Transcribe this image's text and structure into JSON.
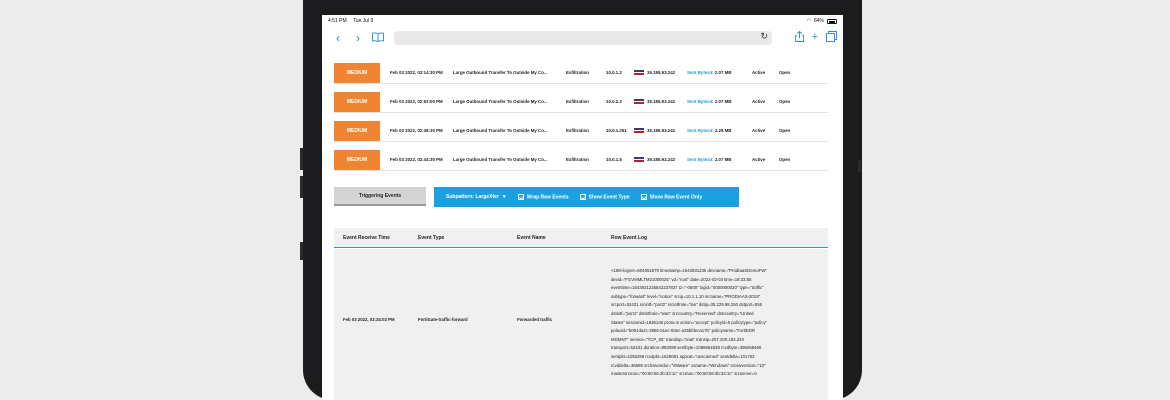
{
  "statusbar": {
    "time": "4:51 PM",
    "date": "Tue Jul 9",
    "battery": "84%"
  },
  "icons": {
    "back": "chevron-left-icon",
    "forward": "chevron-right-icon",
    "bookmarks": "book-icon",
    "reload": "reload-icon",
    "share": "share-icon",
    "new_tab": "plus-icon",
    "tabs": "tabs-icon",
    "wifi": "wifi-icon"
  },
  "colors": {
    "severity": "#ef8532",
    "accent": "#1ba1e2",
    "sent_label": "#1e9bd7"
  },
  "alerts": [
    {
      "severity": "MEDIUM",
      "time": "Feb 03 2022, 03:14:30 PM",
      "name": "Large Outbound Transfer To Outside My Co...",
      "category": "Exfiltration",
      "src_ip": "10.0.1.2",
      "dst_ip": "35.185.93.242",
      "sent_label": "Sent Bytes4:",
      "sent_value": "2.07 MB",
      "status": "Active",
      "state": "Open"
    },
    {
      "severity": "MEDIUM",
      "time": "Feb 03 2022, 02:52:00 PM",
      "name": "Large Outbound Transfer To Outside My Co...",
      "category": "Exfiltration",
      "src_ip": "10.0.2.2",
      "dst_ip": "35.185.93.242",
      "sent_label": "Sent Bytes4:",
      "sent_value": "2.07 MB",
      "status": "Active",
      "state": "Open"
    },
    {
      "severity": "MEDIUM",
      "time": "Feb 03 2022, 02:48:30 PM",
      "name": "Large Outbound Transfer To Outside My Co...",
      "category": "Exfiltration",
      "src_ip": "10.0.1.251",
      "dst_ip": "35.185.93.242",
      "sent_label": "Sent Bytes4:",
      "sent_value": "2.29 MB",
      "status": "Active",
      "state": "Open"
    },
    {
      "severity": "MEDIUM",
      "time": "Feb 03 2022, 02:44:30 PM",
      "name": "Large Outbound Transfer To Outside My Co...",
      "category": "Exfiltration",
      "src_ip": "10.0.1.5",
      "dst_ip": "35.185.93.242",
      "sent_label": "Sent Bytes4:",
      "sent_value": "2.07 MB",
      "status": "Active",
      "state": "Open"
    }
  ],
  "tabs": {
    "triggering_events": "Triggering Events",
    "subpattern": "Subpattern: LargeXfer",
    "wrap_raw": "Wrap Raw Events",
    "show_event_type": "Show Event Type",
    "show_raw_only": "Show Raw Event Only"
  },
  "table": {
    "headers": [
      "Event Receive Time",
      "Event Type",
      "Event Name",
      "Row Event Log"
    ],
    "row": {
      "time": "Feb 03 2022, 03:34:02 PM",
      "type": "FortiGate-traffic-forward",
      "name": "Forwarded traffic",
      "log_lines": [
        "<189>logver=604061879 timestamp=1643931235 devname=\"ProdIaaSDemoFW\"",
        "devid=\"FGVMMLTM21000025\" vd=\"root\" date=2022-02-03 time=18:33:55",
        "eventtime=1643931235842237837 tz=\"-0500\" logid=\"0000000020\" type=\"traffic\"",
        "subtype=\"forward\" level=\"notice\" srcip=10.1.1.10 srcname=\"PRODIAAS-2019\"",
        "srcport=52431 srcintf=\"port2\" srcintfrole=\"lan\" dstip=35.229.98.250 dstport=555",
        "dstintf=\"port1\" dstintfrole=\"wan\" srccountry=\"Reserved\" dstcountry=\"United",
        "States\" sessionid=1836138 proto=6 action=\"accept\" policyid=5 policytype=\"policy\"",
        "poluuid=\"b091da2c-2855-51ec-83ec-a25bfdeca17b\" policyname=\"FortiEDR",
        "MGMNT\" service=\"TCP_55\" trandisp=\"snat\" transip=207.200.183.223",
        "transport=52431 duration=883099 sentbyte=1088654838 rcvdbyte=396058490",
        "sentpkt=2255298 rcvdpkt=1628081 appcat=\"unscanned\" sentdelta=101752",
        "rcvddelta=36586 srchwvendor=\"VMware\" osname=\"Windows\" srcswversion=\"10\"",
        "mastersrcmac=\"00:50:56:3b:33:1c\" srcmac=\"00:50:56:3b:33:1c\" srcserver=0"
      ]
    }
  }
}
